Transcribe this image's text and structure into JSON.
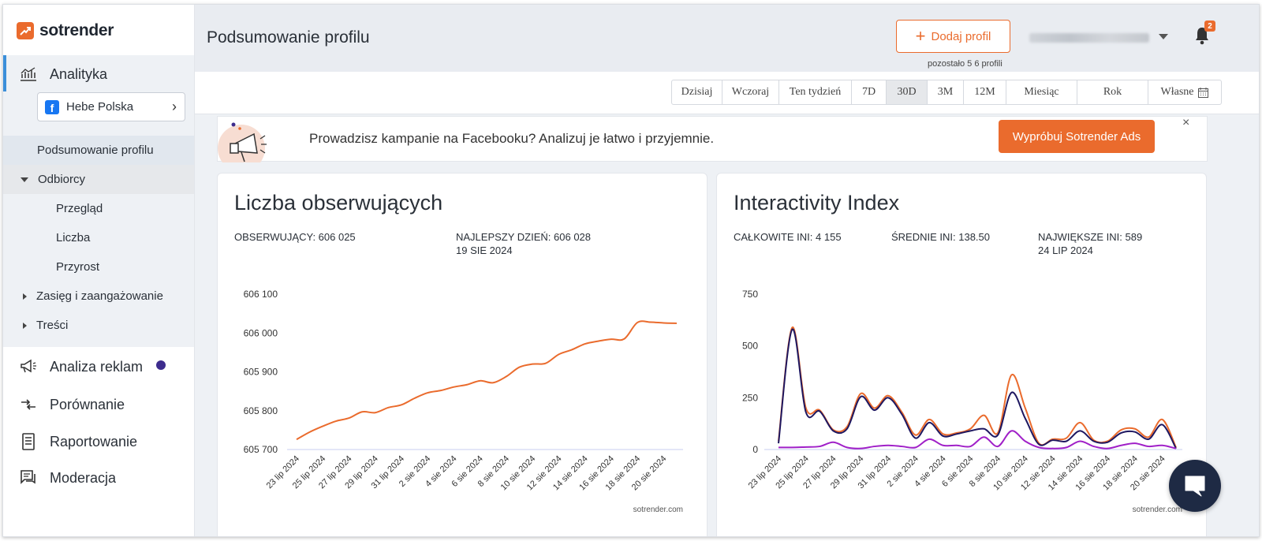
{
  "app": {
    "logo_text": "sotrender"
  },
  "sidebar": {
    "analytics_label": "Analityka",
    "profile_name": "Hebe Polska",
    "subnav": [
      {
        "label": "Podsumowanie profilu"
      },
      {
        "label": "Odbiorcy"
      },
      {
        "label": "Przegląd"
      },
      {
        "label": "Liczba"
      },
      {
        "label": "Przyrost"
      },
      {
        "label": "Zasięg i zaangażowanie"
      },
      {
        "label": "Treści"
      }
    ],
    "main_items": [
      {
        "label": "Analiza reklam",
        "icon": "megaphone-icon"
      },
      {
        "label": "Porównanie",
        "icon": "compare-arrows-icon"
      },
      {
        "label": "Raportowanie",
        "icon": "report-icon"
      },
      {
        "label": "Moderacja",
        "icon": "moderation-icon"
      }
    ]
  },
  "header": {
    "title": "Podsumowanie profilu",
    "add_profile_label": "Dodaj profil",
    "remaining_text": "pozostało 5  6 profili",
    "notification_count": "2"
  },
  "range": {
    "options": [
      "Dzisiaj",
      "Wczoraj",
      "Ten tydzień",
      "7D",
      "30D",
      "3M",
      "12M",
      "Miesiąc",
      "Rok",
      "Własne"
    ],
    "selected": "30D"
  },
  "banner": {
    "text": "Prowadzisz kampanie na Facebooku? Analizuj je łatwo i przyjemnie.",
    "button_label": "Wypróbuj Sotrender Ads",
    "close_label": "×"
  },
  "colors": {
    "accent": "#ea6b2d",
    "navy": "#1e1760",
    "purple": "#a020c8"
  },
  "followers_card": {
    "title": "Liczba obserwujących",
    "stat_followers": "OBSERWUJĄCY: 606 025",
    "stat_best_day": "NAJLEPSZY DZIEŃ: 606 028",
    "stat_best_date": "19 SIE 2024",
    "watermark": "sotrender.com"
  },
  "ini_card": {
    "title": "Interactivity Index",
    "stat_total": "CAŁKOWITE INI: 4 155",
    "stat_avg": "ŚREDNIE INI: 138.50",
    "stat_max": "NAJWIĘKSZE INI: 589",
    "stat_max_date": "24 LIP 2024",
    "watermark": "sotrender.com"
  },
  "chart_data": [
    {
      "type": "line",
      "x": [
        "23 lip 2024",
        "24 lip 2024",
        "25 lip 2024",
        "26 lip 2024",
        "27 lip 2024",
        "28 lip 2024",
        "29 lip 2024",
        "30 lip 2024",
        "31 lip 2024",
        "1 sie 2024",
        "2 sie 2024",
        "3 sie 2024",
        "4 sie 2024",
        "5 sie 2024",
        "6 sie 2024",
        "7 sie 2024",
        "8 sie 2024",
        "9 sie 2024",
        "10 sie 2024",
        "11 sie 2024",
        "12 sie 2024",
        "13 sie 2024",
        "14 sie 2024",
        "15 sie 2024",
        "16 sie 2024",
        "17 sie 2024",
        "18 sie 2024",
        "19 sie 2024",
        "20 sie 2024",
        "21 sie 2024"
      ],
      "x_tick_labels": [
        "23 lip 2024",
        "25 lip 2024",
        "27 lip 2024",
        "29 lip 2024",
        "31 lip 2024",
        "2 sie 2024",
        "4 sie 2024",
        "6 sie 2024",
        "8 sie 2024",
        "10 sie 2024",
        "12 sie 2024",
        "14 sie 2024",
        "16 sie 2024",
        "18 sie 2024",
        "20 sie 2024"
      ],
      "y_tick_labels": [
        "606 100",
        "606 000",
        "605 900",
        "605 800",
        "605 700"
      ],
      "ylim": [
        605700,
        606100
      ],
      "series": [
        {
          "color": "#ea6b2d",
          "values": [
            605726,
            605745,
            605760,
            605773,
            605781,
            605797,
            605795,
            605808,
            605815,
            605832,
            605846,
            605852,
            605861,
            605867,
            605877,
            605872,
            605888,
            605912,
            605920,
            605922,
            605945,
            605957,
            605972,
            605979,
            605984,
            605985,
            606027,
            606028,
            606026,
            606025
          ]
        }
      ]
    },
    {
      "type": "line",
      "x": [
        "23 lip 2024",
        "24 lip 2024",
        "25 lip 2024",
        "26 lip 2024",
        "27 lip 2024",
        "28 lip 2024",
        "29 lip 2024",
        "30 lip 2024",
        "31 lip 2024",
        "1 sie 2024",
        "2 sie 2024",
        "3 sie 2024",
        "4 sie 2024",
        "5 sie 2024",
        "6 sie 2024",
        "7 sie 2024",
        "8 sie 2024",
        "9 sie 2024",
        "10 sie 2024",
        "11 sie 2024",
        "12 sie 2024",
        "13 sie 2024",
        "14 sie 2024",
        "15 sie 2024",
        "16 sie 2024",
        "17 sie 2024",
        "18 sie 2024",
        "19 sie 2024",
        "20 sie 2024",
        "21 sie 2024"
      ],
      "x_tick_labels": [
        "23 lip 2024",
        "25 lip 2024",
        "27 lip 2024",
        "29 lip 2024",
        "31 lip 2024",
        "2 sie 2024",
        "4 sie 2024",
        "6 sie 2024",
        "8 sie 2024",
        "10 sie 2024",
        "12 sie 2024",
        "14 sie 2024",
        "16 sie 2024",
        "18 sie 2024",
        "20 sie 2024"
      ],
      "y_tick_labels": [
        "750",
        "500",
        "250",
        "0"
      ],
      "ylim": [
        0,
        750
      ],
      "series": [
        {
          "color": "#ea6b2d",
          "values": [
            40,
            589,
            200,
            190,
            95,
            110,
            270,
            200,
            260,
            180,
            70,
            145,
            75,
            80,
            100,
            165,
            80,
            360,
            200,
            30,
            50,
            55,
            130,
            45,
            40,
            95,
            100,
            60,
            145,
            10
          ]
        },
        {
          "color": "#1e1760",
          "values": [
            30,
            580,
            180,
            185,
            90,
            100,
            255,
            190,
            250,
            170,
            55,
            130,
            65,
            75,
            90,
            100,
            70,
            275,
            150,
            25,
            45,
            40,
            90,
            40,
            35,
            80,
            85,
            50,
            120,
            5
          ]
        },
        {
          "color": "#a020c8",
          "values": [
            10,
            10,
            12,
            15,
            35,
            10,
            5,
            15,
            20,
            15,
            10,
            50,
            20,
            20,
            15,
            60,
            15,
            90,
            40,
            10,
            5,
            10,
            40,
            15,
            5,
            20,
            30,
            15,
            20,
            5
          ]
        }
      ]
    }
  ]
}
